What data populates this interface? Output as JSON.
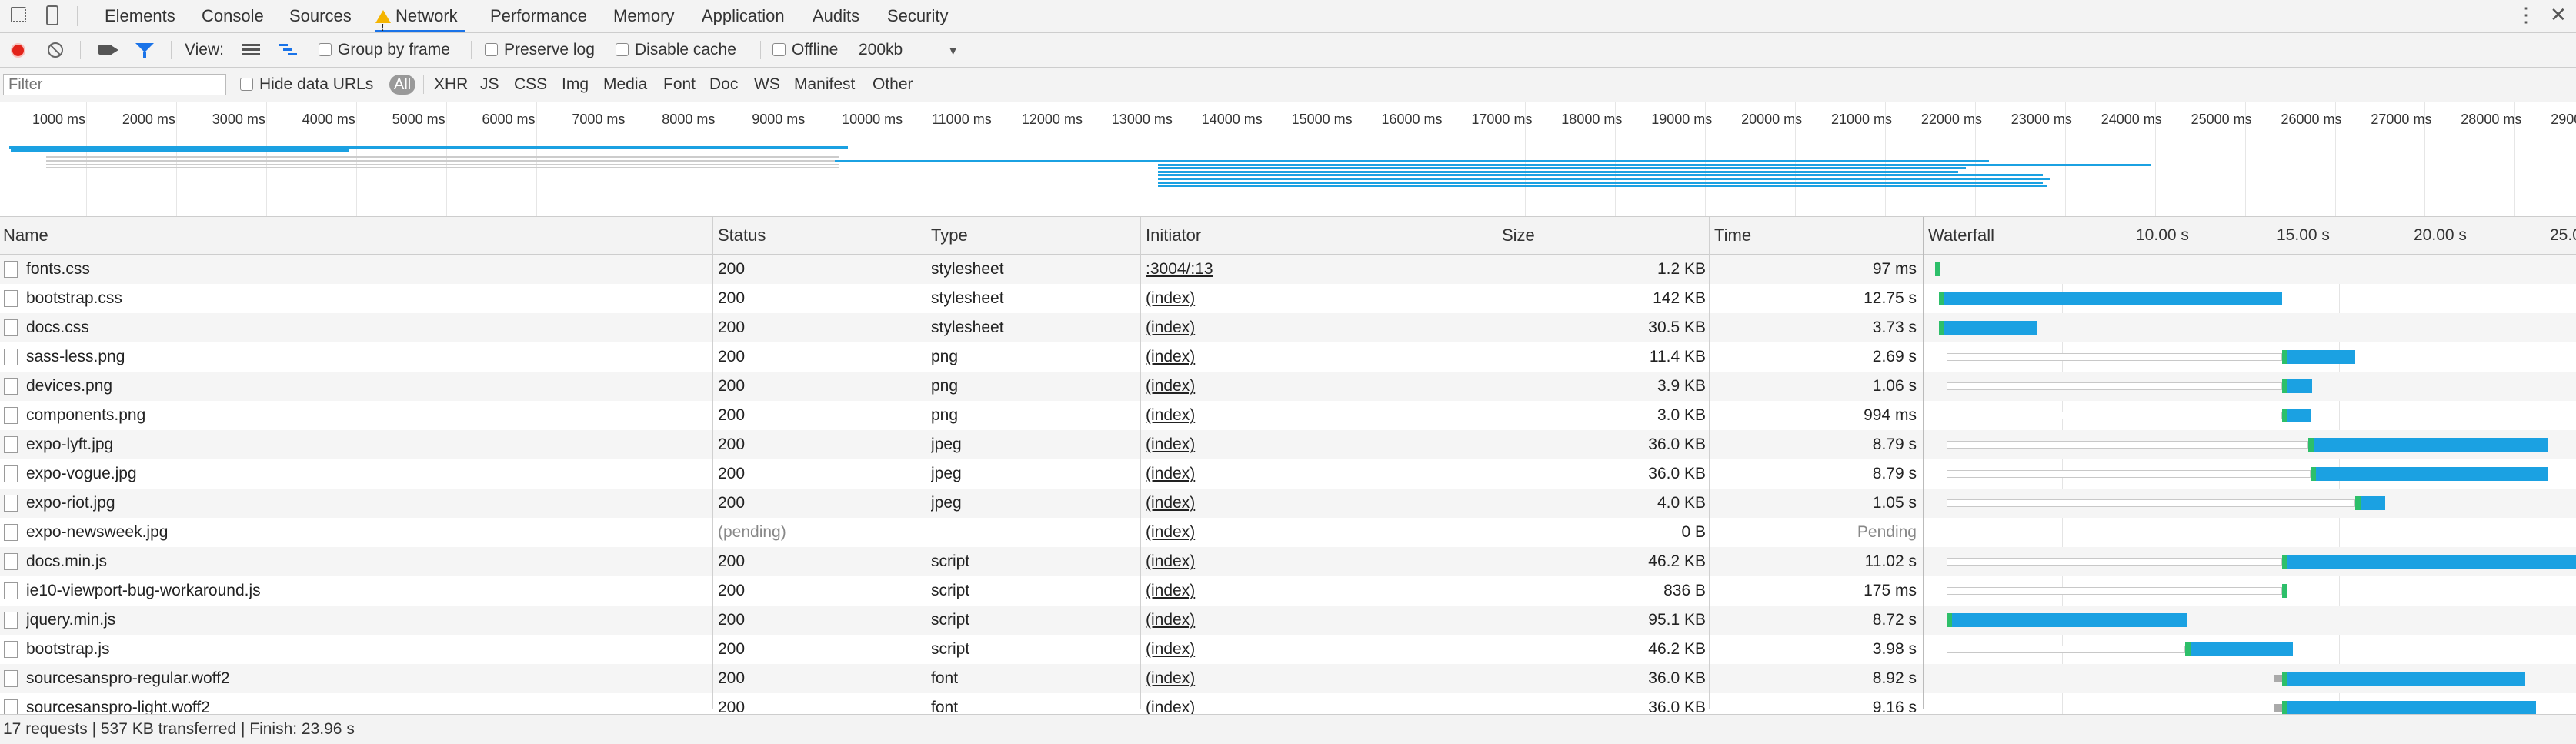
{
  "tabs": [
    {
      "label": "Elements"
    },
    {
      "label": "Console"
    },
    {
      "label": "Sources"
    },
    {
      "label": "Network"
    },
    {
      "label": "Performance"
    },
    {
      "label": "Memory"
    },
    {
      "label": "Application"
    },
    {
      "label": "Audits"
    },
    {
      "label": "Security"
    }
  ],
  "toolbar": {
    "view_label": "View:",
    "group_by_frame": "Group by frame",
    "preserve_log": "Preserve log",
    "disable_cache": "Disable cache",
    "offline": "Offline",
    "throttle": "200kb"
  },
  "filter": {
    "placeholder": "Filter",
    "hide_data_urls": "Hide data URLs",
    "types": [
      "All",
      "XHR",
      "JS",
      "CSS",
      "Img",
      "Media",
      "Font",
      "Doc",
      "WS",
      "Manifest",
      "Other"
    ]
  },
  "overview": {
    "ticks": [
      "1000 ms",
      "2000 ms",
      "3000 ms",
      "4000 ms",
      "5000 ms",
      "6000 ms",
      "7000 ms",
      "8000 ms",
      "9000 ms",
      "10000 ms",
      "11000 ms",
      "12000 ms",
      "13000 ms",
      "14000 ms",
      "15000 ms",
      "16000 ms",
      "17000 ms",
      "18000 ms",
      "19000 ms",
      "20000 ms",
      "21000 ms",
      "22000 ms",
      "23000 ms",
      "24000 ms",
      "25000 ms",
      "26000 ms",
      "27000 ms",
      "28000 ms",
      "2900"
    ]
  },
  "columns": {
    "name": "Name",
    "status": "Status",
    "type": "Type",
    "initiator": "Initiator",
    "size": "Size",
    "time": "Time",
    "waterfall": "Waterfall",
    "wf_ticks": [
      "10.00 s",
      "15.00 s",
      "20.00 s",
      "25.0"
    ]
  },
  "requests": [
    {
      "name": "fonts.css",
      "status": "200",
      "type": "stylesheet",
      "initiator": ":3004/:13",
      "size": "1.2 KB",
      "time": "97 ms"
    },
    {
      "name": "bootstrap.css",
      "status": "200",
      "type": "stylesheet",
      "initiator": "(index)",
      "size": "142 KB",
      "time": "12.75 s"
    },
    {
      "name": "docs.css",
      "status": "200",
      "type": "stylesheet",
      "initiator": "(index)",
      "size": "30.5 KB",
      "time": "3.73 s"
    },
    {
      "name": "sass-less.png",
      "status": "200",
      "type": "png",
      "initiator": "(index)",
      "size": "11.4 KB",
      "time": "2.69 s"
    },
    {
      "name": "devices.png",
      "status": "200",
      "type": "png",
      "initiator": "(index)",
      "size": "3.9 KB",
      "time": "1.06 s"
    },
    {
      "name": "components.png",
      "status": "200",
      "type": "png",
      "initiator": "(index)",
      "size": "3.0 KB",
      "time": "994 ms"
    },
    {
      "name": "expo-lyft.jpg",
      "status": "200",
      "type": "jpeg",
      "initiator": "(index)",
      "size": "36.0 KB",
      "time": "8.79 s"
    },
    {
      "name": "expo-vogue.jpg",
      "status": "200",
      "type": "jpeg",
      "initiator": "(index)",
      "size": "36.0 KB",
      "time": "8.79 s"
    },
    {
      "name": "expo-riot.jpg",
      "status": "200",
      "type": "jpeg",
      "initiator": "(index)",
      "size": "4.0 KB",
      "time": "1.05 s"
    },
    {
      "name": "expo-newsweek.jpg",
      "status": "(pending)",
      "type": "",
      "initiator": "(index)",
      "size": "0 B",
      "time": "Pending"
    },
    {
      "name": "docs.min.js",
      "status": "200",
      "type": "script",
      "initiator": "(index)",
      "size": "46.2 KB",
      "time": "11.02 s"
    },
    {
      "name": "ie10-viewport-bug-workaround.js",
      "status": "200",
      "type": "script",
      "initiator": "(index)",
      "size": "836 B",
      "time": "175 ms"
    },
    {
      "name": "jquery.min.js",
      "status": "200",
      "type": "script",
      "initiator": "(index)",
      "size": "95.1 KB",
      "time": "8.72 s"
    },
    {
      "name": "bootstrap.js",
      "status": "200",
      "type": "script",
      "initiator": "(index)",
      "size": "46.2 KB",
      "time": "3.98 s"
    },
    {
      "name": "sourcesanspro-regular.woff2",
      "status": "200",
      "type": "font",
      "initiator": "(index)",
      "size": "36.0 KB",
      "time": "8.92 s"
    },
    {
      "name": "sourcesanspro-light.woff2",
      "status": "200",
      "type": "font",
      "initiator": "(index)",
      "size": "36.0 KB",
      "time": "9.16 s"
    }
  ],
  "status_bar": "17 requests | 537 KB transferred | Finish: 23.96 s",
  "colors": {
    "accent": "#1a73e8",
    "bar_blue": "#1ba1e2",
    "bar_green": "#2dbf6a",
    "record_red": "#e2231a"
  }
}
